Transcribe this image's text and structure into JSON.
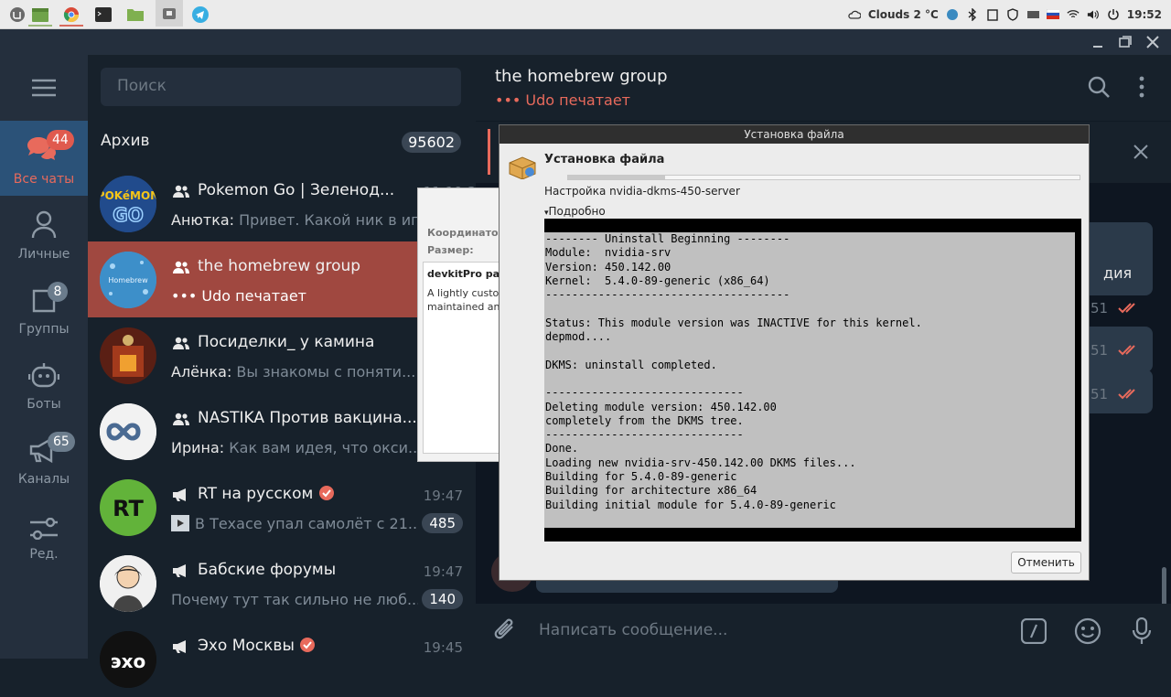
{
  "taskbar": {
    "apps": [
      "mint-menu-icon",
      "file-manager-icon",
      "chrome-icon",
      "terminal-icon",
      "folder-icon",
      "package-installer-icon",
      "telegram-icon"
    ],
    "weather": "Clouds 2 °C",
    "clock": "19:52"
  },
  "sidebar": {
    "items": [
      {
        "label": "Все чаты",
        "badge": "44",
        "icon": "chat-bubbles-icon"
      },
      {
        "label": "Личные",
        "badge": "",
        "icon": "person-icon"
      },
      {
        "label": "Группы",
        "badge": "8",
        "icon": "group-icon"
      },
      {
        "label": "Боты",
        "badge": "",
        "icon": "bot-icon"
      },
      {
        "label": "Каналы",
        "badge": "65",
        "icon": "channel-icon"
      },
      {
        "label": "Ред.",
        "badge": "",
        "icon": "sliders-icon"
      }
    ]
  },
  "search": {
    "placeholder": "Поиск"
  },
  "archive": {
    "label": "Архив",
    "count": "95602"
  },
  "chats": [
    {
      "name": "Pokemon Go | Зеленод...",
      "time": "11:19:31",
      "sender": "Анютка:",
      "preview": " Привет. Какой ник в иг...",
      "badge": "",
      "type": "group"
    },
    {
      "name": "the homebrew group",
      "time": "",
      "sender": "",
      "preview": "••• Udo печатает",
      "badge": "",
      "type": "group"
    },
    {
      "name": "Посиделки_ у камина",
      "time": "",
      "sender": "Алёнка:",
      "preview": " Вы знакомы с поняти...",
      "badge": "",
      "type": "group"
    },
    {
      "name": "NASTIKA Против вакцина...",
      "time": "",
      "sender": "Ирина:",
      "preview": " Как вам идея, что окси...",
      "badge": "",
      "type": "group"
    },
    {
      "name": "RT на русском",
      "time": "19:47",
      "sender": "",
      "preview": "В Техасе упал самолёт с 21...",
      "badge": "485",
      "type": "channel"
    },
    {
      "name": "Бабские форумы",
      "time": "19:47",
      "sender": "",
      "preview": "Почему тут так сильно не люб...",
      "badge": "140",
      "type": "channel"
    },
    {
      "name": "Эхо Москвы",
      "time": "19:45",
      "sender": "",
      "preview": "",
      "badge": "",
      "type": "channel"
    }
  ],
  "chat": {
    "title": "the homebrew group",
    "status": "••• Udo печатает",
    "composer_placeholder": "Написать сообщение...",
    "visible_fragments": [
      "дия",
      "51",
      "51",
      "51"
    ]
  },
  "behind_window": {
    "label1": "Координатор",
    "label2": "Размер:",
    "heading": "devkitPro pac",
    "text1": "A lightly custo",
    "text2": "maintained an"
  },
  "installer": {
    "window_title": "Установка файла",
    "heading": "Установка файла",
    "subtitle": "Настройка nvidia-dkms-450-server",
    "details_label": "Подробно",
    "progress_fraction": 0.19,
    "terminal_lines": [
      "-------- Uninstall Beginning --------",
      "Module:  nvidia-srv",
      "Version: 450.142.00",
      "Kernel:  5.4.0-89-generic (x86_64)",
      "-------------------------------------",
      "",
      "Status: This module version was INACTIVE for this kernel.",
      "depmod....",
      "",
      "DKMS: uninstall completed.",
      "",
      "------------------------------",
      "Deleting module version: 450.142.00",
      "completely from the DKMS tree.",
      "------------------------------",
      "Done.",
      "Loading new nvidia-srv-450.142.00 DKMS files...",
      "Building for 5.4.0-89-generic",
      "Building for architecture x86_64",
      "Building initial module for 5.4.0-89-generic",
      ""
    ],
    "cancel_label": "Отменить"
  },
  "colors": {
    "accent_red": "#e05a4e",
    "selected_row": "#a04840",
    "panel_bg": "#17212b"
  }
}
